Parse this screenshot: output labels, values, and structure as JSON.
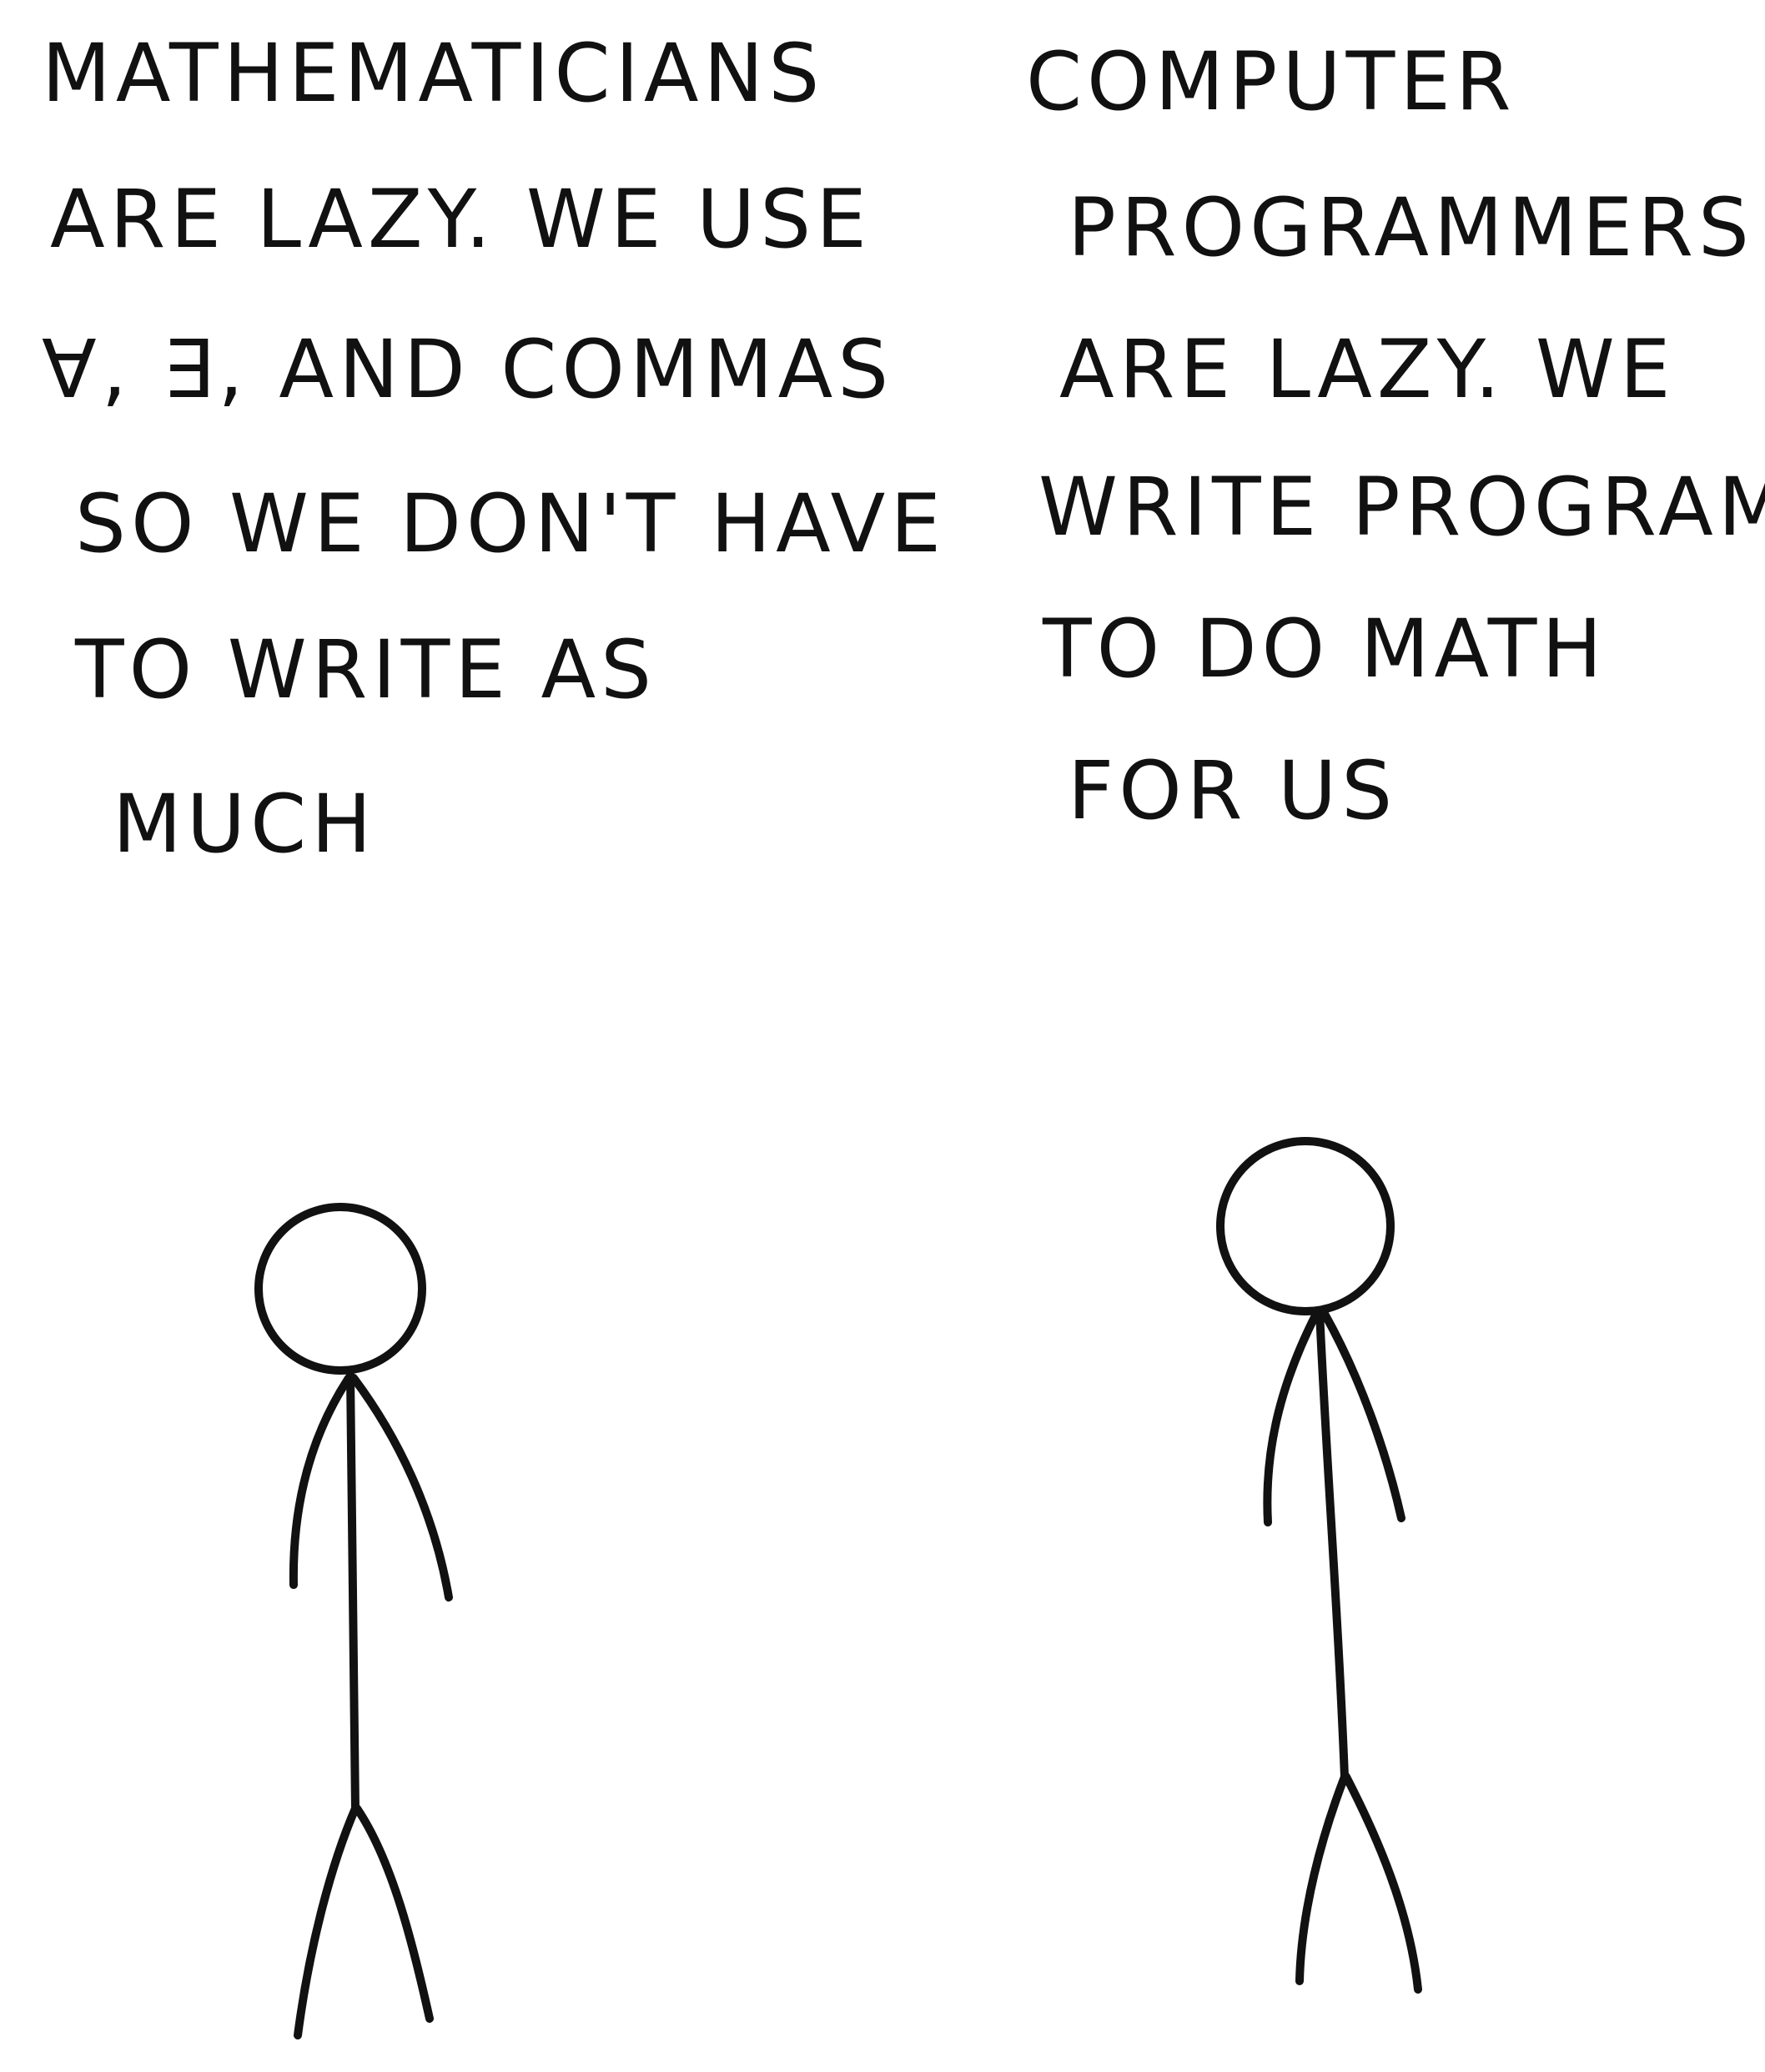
{
  "left_panel": {
    "caption_lines": [
      "MATHEMATICIANS",
      "ARE LAZY. WE USE",
      "∀, ∃, AND COMMAS",
      "SO WE DON'T HAVE",
      "TO WRITE AS",
      "MUCH"
    ]
  },
  "right_panel": {
    "caption_lines": [
      "COMPUTER",
      "PROGRAMMERS",
      "ARE LAZY. WE",
      "WRITE PROGRAMS",
      "TO DO MATH",
      "FOR US"
    ]
  },
  "colors": {
    "ink": "#111111",
    "background": "#ffffff"
  }
}
